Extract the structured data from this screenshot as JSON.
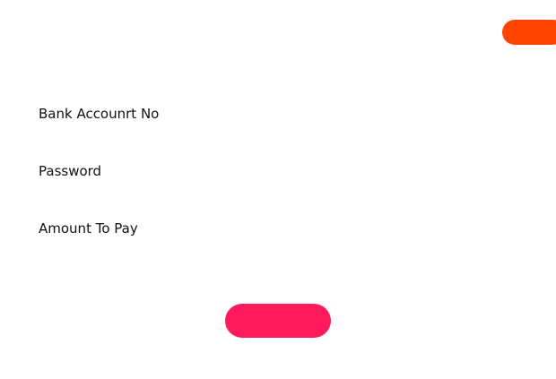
{
  "colors": {
    "corner_button": "#ff4500",
    "submit_button": "#ff1a5e",
    "background": "#ffffff",
    "text": "#111111"
  },
  "form": {
    "fields": [
      {
        "label": "Bank Accounrt No"
      },
      {
        "label": "Password"
      },
      {
        "label": "Amount To Pay"
      }
    ]
  }
}
